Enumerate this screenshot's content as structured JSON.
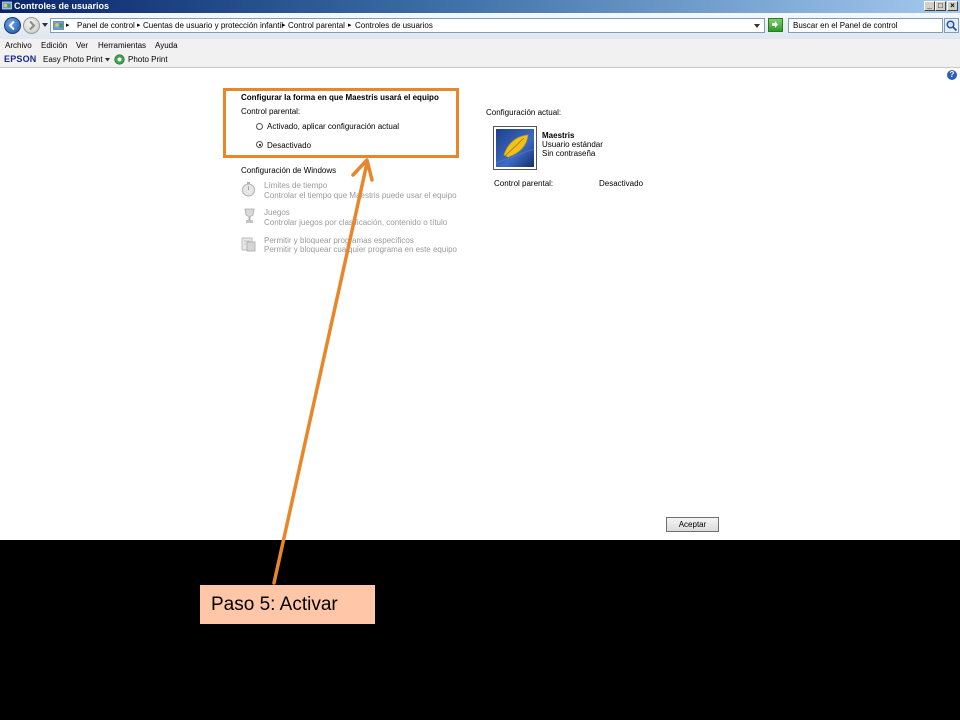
{
  "window": {
    "title": "Controles de usuarios",
    "controls": {
      "minimize": "_",
      "maximize": "□",
      "close": "×"
    }
  },
  "address_bar": {
    "breadcrumbs": [
      "Panel de control",
      "Cuentas de usuario y protección infantil",
      "Control parental",
      "Controles de usuarios"
    ],
    "search_placeholder": "Buscar en el Panel de control"
  },
  "menu": {
    "items": [
      "Archivo",
      "Edición",
      "Ver",
      "Herramientas",
      "Ayuda"
    ]
  },
  "toolbar": {
    "brand": "EPSON",
    "easy_photo_print": "Easy Photo Print",
    "photo_print": "Photo Print"
  },
  "settings": {
    "heading": "Configurar la forma en que Maestris usará el equipo",
    "parental_label": "Control parental:",
    "options": [
      {
        "label": "Activado, aplicar configuración actual",
        "selected": false
      },
      {
        "label": "Desactivado",
        "selected": true
      }
    ],
    "windows_heading": "Configuración de Windows",
    "windows_items": [
      {
        "title": "Límites de tiempo",
        "desc": "Controlar el tiempo que Maestris puede usar el equipo",
        "icon": "stopwatch-icon"
      },
      {
        "title": "Juegos",
        "desc": "Controlar juegos por clasificación, contenido o título",
        "icon": "trophy-icon"
      },
      {
        "title": "Permitir y bloquear programas específicos",
        "desc": "Permitir y bloquear cualquier programa en este equipo",
        "icon": "program-block-icon"
      }
    ]
  },
  "current_config": {
    "heading": "Configuración actual:",
    "user_name": "Maestris",
    "user_type": "Usuario estándar",
    "user_password": "Sin contraseña",
    "parental_label": "Control parental:",
    "parental_value": "Desactivado"
  },
  "buttons": {
    "accept": "Aceptar"
  },
  "annotation": {
    "callout": "Paso 5: Activar",
    "color": "#e9862a"
  },
  "colors": {
    "title_bar": "#0a246a",
    "highlight": "#e9862a",
    "callout_bg": "#ffc7a8"
  }
}
